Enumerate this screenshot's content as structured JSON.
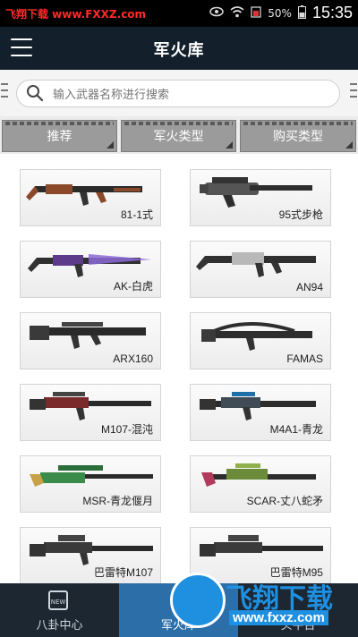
{
  "status_bar": {
    "watermark": "飞翔下载 www.FXXZ.com",
    "battery": "50%",
    "time": "15:35"
  },
  "header": {
    "title": "军火库"
  },
  "search": {
    "placeholder": "输入武器名称进行搜索"
  },
  "filters": [
    {
      "label": "推荐"
    },
    {
      "label": "军火类型"
    },
    {
      "label": "购买类型"
    }
  ],
  "weapons": [
    {
      "name": "81-1式"
    },
    {
      "name": "95式步枪"
    },
    {
      "name": "AK-白虎"
    },
    {
      "name": "AN94"
    },
    {
      "name": "ARX160"
    },
    {
      "name": "FAMAS"
    },
    {
      "name": "M107-混沌"
    },
    {
      "name": "M4A1-青龙"
    },
    {
      "name": "MSR-青龙偃月"
    },
    {
      "name": "SCAR-丈八蛇矛"
    },
    {
      "name": "巴雷特M107"
    },
    {
      "name": "巴雷特M95"
    }
  ],
  "bottom_nav": [
    {
      "label": "八卦中心",
      "icon_text": "NEW"
    },
    {
      "label": "军火库"
    },
    {
      "label": "头牛台"
    }
  ],
  "watermark_overlay": {
    "text": "飞翔下载",
    "url": "www.fxxz.com"
  },
  "colors": {
    "appbar": "#13202b",
    "nav_active": "#2b6ea8",
    "filter_tab": "#9b9b9b"
  }
}
